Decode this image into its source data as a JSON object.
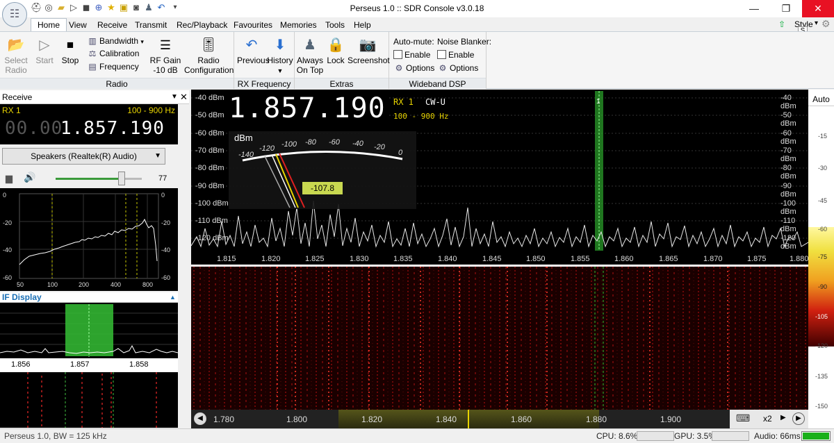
{
  "window": {
    "title": "Perseus 1.0 :: SDR Console v3.0.18",
    "minimize": "—",
    "maximize": "❐",
    "close": "✕",
    "style_label": "Style",
    "style_tip": "S"
  },
  "tabs": [
    "Home",
    "View",
    "Receive",
    "Transmit",
    "Rec/Playback",
    "Favourites",
    "Memories",
    "Tools",
    "Help"
  ],
  "ribbon": {
    "radio": {
      "select": "Select\nRadio",
      "start": "Start",
      "stop": "Stop",
      "bandwidth": "Bandwidth",
      "calibration": "Calibration",
      "frequency": "Frequency",
      "rfgain": "RF Gain",
      "rfgain_value": "-10 dB",
      "radio_config": "Radio\nConfiguration",
      "group": "Radio"
    },
    "rxfreq": {
      "prev": "Previous",
      "history": "History",
      "group": "RX Frequency"
    },
    "extras": {
      "always": "Always\nOn Top",
      "lock": "Lock",
      "screenshot": "Screenshot",
      "group": "Extras"
    },
    "dsp": {
      "automute": "Auto-mute:",
      "enable1": "Enable",
      "options1": "Options",
      "noise": "Noise Blanker:",
      "enable2": "Enable",
      "options2": "Options",
      "group": "Wideband DSP"
    }
  },
  "receive_panel": {
    "title": "Receive",
    "rx": "RX 1",
    "range": "100 - 900 Hz",
    "freq_dim": "00.00",
    "freq": "1.857.190",
    "audio_device": "Speakers (Realtek(R) Audio)",
    "volume": 77
  },
  "af_scope": {
    "left_ticks": [
      "0",
      "-20",
      "-40",
      "-60"
    ],
    "right_ticks": [
      "0",
      "-20",
      "-40",
      "-60"
    ],
    "x_ticks": [
      "50",
      "100",
      "200",
      "400",
      "800"
    ]
  },
  "if_display": {
    "title": "IF Display",
    "x_ticks": [
      "1.856",
      "1.857",
      "1.858"
    ]
  },
  "spectrum": {
    "freq": "1.857.190",
    "rx": "RX 1",
    "mode": "CW-U",
    "range": "100 - 900 Hz",
    "meter_unit": "dBm",
    "meter_scale": [
      "-140",
      "-120",
      "-100",
      "-80",
      "-60",
      "-40",
      "-20",
      "0"
    ],
    "meter_value": "-107.8",
    "left_dbm": [
      "-40 dBm",
      "-50 dBm",
      "-60 dBm",
      "-70 dBm",
      "-80 dBm",
      "-90 dBm",
      "-100 dBm",
      "-110 dBm",
      "-120 dBm"
    ],
    "right_dbm": [
      "-40 dBm",
      "-50 dBm",
      "-60 dBm",
      "-70 dBm",
      "-80 dBm",
      "-90 dBm",
      "-100 dBm",
      "-110 dBm",
      "-120 dBm"
    ],
    "freq_ticks": [
      "1.815",
      "1.820",
      "1.825",
      "1.830",
      "1.835",
      "1.840",
      "1.845",
      "1.850",
      "1.855",
      "1.860",
      "1.865",
      "1.870",
      "1.875",
      "1.880"
    ],
    "marker": "1"
  },
  "right_scale": {
    "auto": "Auto",
    "top_ticks": [
      "-15",
      "-30",
      "-45",
      "-60"
    ],
    "color_ticks": [
      "-75",
      "-90",
      "-105",
      "-120"
    ],
    "bottom_ticks": [
      "-135",
      "-150"
    ]
  },
  "bottom_axis": {
    "ticks": [
      "1.780",
      "1.800",
      "1.820",
      "1.840",
      "1.860",
      "1.880",
      "1.900"
    ],
    "zoom": "x2"
  },
  "status": {
    "left": "Perseus 1.0, BW = 125 kHz",
    "cpu": "CPU: 8.6%",
    "gpu": "GPU: 3.5%",
    "audio": "Audio: 66ms"
  },
  "colors": {
    "accent": "#2a9d2a",
    "rx_yellow": "#e8d400",
    "meter_value_bg": "#c8d850"
  }
}
